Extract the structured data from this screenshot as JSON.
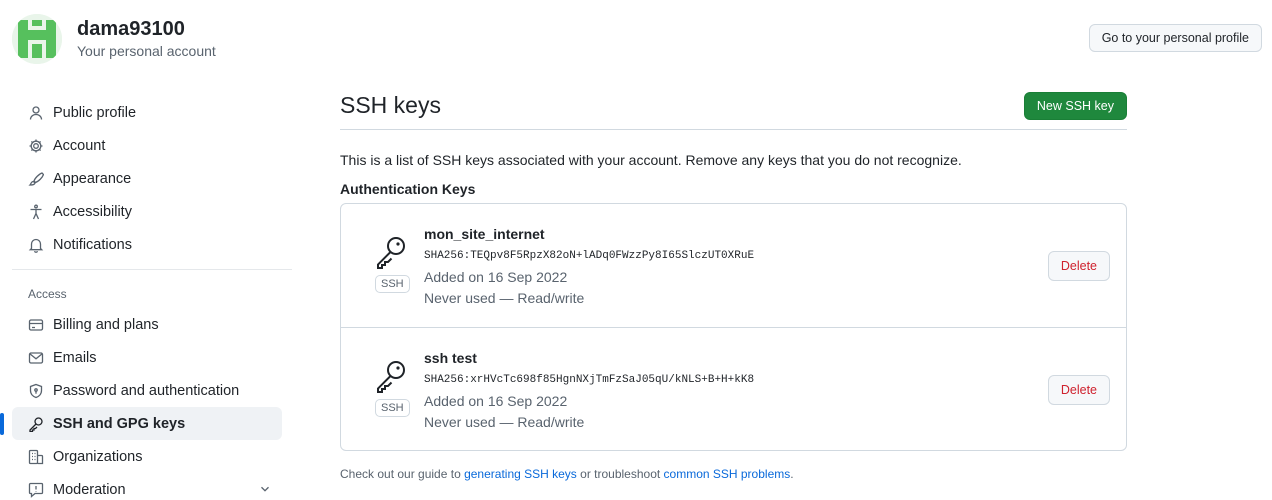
{
  "account": {
    "username": "dama93100",
    "subtitle": "Your personal account",
    "profile_button": "Go to your personal profile"
  },
  "sidebar": {
    "items": [
      {
        "label": "Public profile",
        "icon": "person-icon"
      },
      {
        "label": "Account",
        "icon": "gear-icon"
      },
      {
        "label": "Appearance",
        "icon": "paintbrush-icon"
      },
      {
        "label": "Accessibility",
        "icon": "accessibility-icon"
      },
      {
        "label": "Notifications",
        "icon": "bell-icon"
      }
    ],
    "access_heading": "Access",
    "access_items": [
      {
        "label": "Billing and plans",
        "icon": "credit-card-icon"
      },
      {
        "label": "Emails",
        "icon": "mail-icon"
      },
      {
        "label": "Password and authentication",
        "icon": "shield-lock-icon"
      },
      {
        "label": "SSH and GPG keys",
        "icon": "key-icon",
        "active": true
      },
      {
        "label": "Organizations",
        "icon": "organization-icon"
      },
      {
        "label": "Moderation",
        "icon": "report-icon"
      }
    ]
  },
  "main": {
    "title": "SSH keys",
    "new_key_button": "New SSH key",
    "description": "This is a list of SSH keys associated with your account. Remove any keys that you do not recognize.",
    "section_heading": "Authentication Keys",
    "keys": [
      {
        "title": "mon_site_internet",
        "fingerprint": "SHA256:TEQpv8F5RpzX82oN+lADq0FWzzPy8I65SlczUT0XRuE",
        "added": "Added on 16 Sep 2022",
        "usage": "Never used — Read/write",
        "badge": "SSH",
        "delete_label": "Delete"
      },
      {
        "title": "ssh test",
        "fingerprint": "SHA256:xrHVcTc698f85HgnNXjTmFzSaJ05qU/kNLS+B+H+kK8",
        "added": "Added on 16 Sep 2022",
        "usage": "Never used — Read/write",
        "badge": "SSH",
        "delete_label": "Delete"
      }
    ],
    "footer": {
      "prefix": "Check out our guide to ",
      "link1": "generating SSH keys",
      "middle": " or troubleshoot ",
      "link2": "common SSH problems",
      "suffix": "."
    }
  },
  "colors": {
    "accent": "#0969da",
    "primary_button": "#1f883d",
    "danger": "#cf222e"
  }
}
